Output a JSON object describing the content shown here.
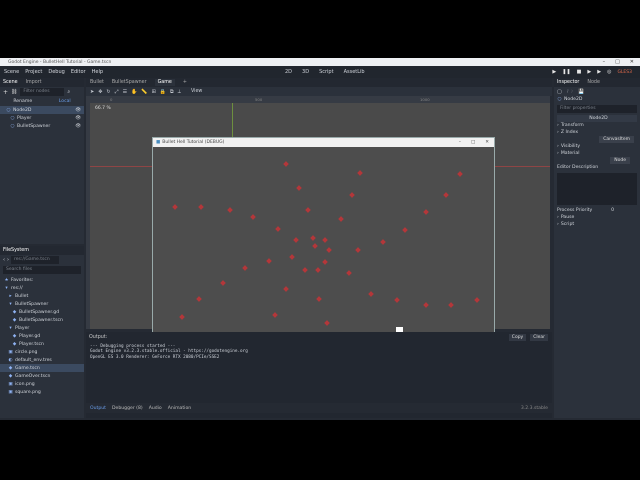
{
  "window_title": "Godot Engine - BulletHell Tutorial - Game.tscn",
  "menu": [
    "Scene",
    "Project",
    "Debug",
    "Editor",
    "Help"
  ],
  "workspaces": [
    "2D",
    "3D",
    "Script",
    "AssetLib"
  ],
  "run_buttons": [
    "▶",
    "❚❚",
    "■",
    "▶",
    "▶",
    "◎"
  ],
  "gles_label": "GLES3",
  "scene_dock": {
    "tabs": [
      "Scene",
      "Import"
    ],
    "filter_placeholder": "Filter nodes",
    "buttons": [
      "Rename",
      "Local"
    ],
    "nodes": [
      {
        "label": "Node2D",
        "selected": true
      },
      {
        "label": "Player",
        "selected": false
      },
      {
        "label": "BulletSpawner",
        "selected": false
      }
    ]
  },
  "filesystem": {
    "title": "FileSystem",
    "path": "res://Game.tscn",
    "search_placeholder": "Search files",
    "items": [
      "Favorites:",
      "res://",
      "Bullet",
      "BulletSpawner",
      "BulletSpawner.gd",
      "BulletSpawner.tscn",
      "Player",
      "Player.gd",
      "Player.tscn",
      "circle.png",
      "default_env.tres",
      "Game.tscn",
      "GameOver.tscn",
      "icon.png",
      "square.png"
    ]
  },
  "editor_tabs": [
    "Bullet",
    "BulletSpawner",
    "Game"
  ],
  "viewport": {
    "zoom": "66.7 %",
    "view_label": "View",
    "ruler_ticks": [
      "0",
      "500",
      "1000"
    ]
  },
  "game_window": {
    "title": "Bullet Hell Tutorial (DEBUG)",
    "controls": [
      "–",
      "□",
      "✕"
    ]
  },
  "output": {
    "title": "Output:",
    "copy": "Copy",
    "clear": "Clear",
    "lines": [
      "--- Debugging process started ---",
      "Godot Engine v3.2.3.stable.official - https://godotengine.org",
      "OpenGL ES 3.0 Renderer: GeForce RTX 2080/PCIe/SSE2"
    ]
  },
  "bottom_tabs": [
    "Output",
    "Debugger (8)",
    "Audio",
    "Animation"
  ],
  "version": "3.2.3.stable",
  "inspector": {
    "tabs": [
      "Inspector",
      "Node"
    ],
    "node_name": "Node2D",
    "filter_placeholder": "Filter properties",
    "class_label": "Node2D",
    "sections": [
      "Transform",
      "Z Index"
    ],
    "canvas_item": "CanvasItem",
    "sections2": [
      "Visibility",
      "Material"
    ],
    "node_label": "Node",
    "editor_description": "Editor Description",
    "process_priority_label": "Process Priority",
    "process_priority_value": "0",
    "sections3": [
      "Pause",
      "Script"
    ]
  },
  "colors": {
    "bullet": "#b3373a",
    "player": "#ffffff",
    "accent": "#699ce8"
  }
}
